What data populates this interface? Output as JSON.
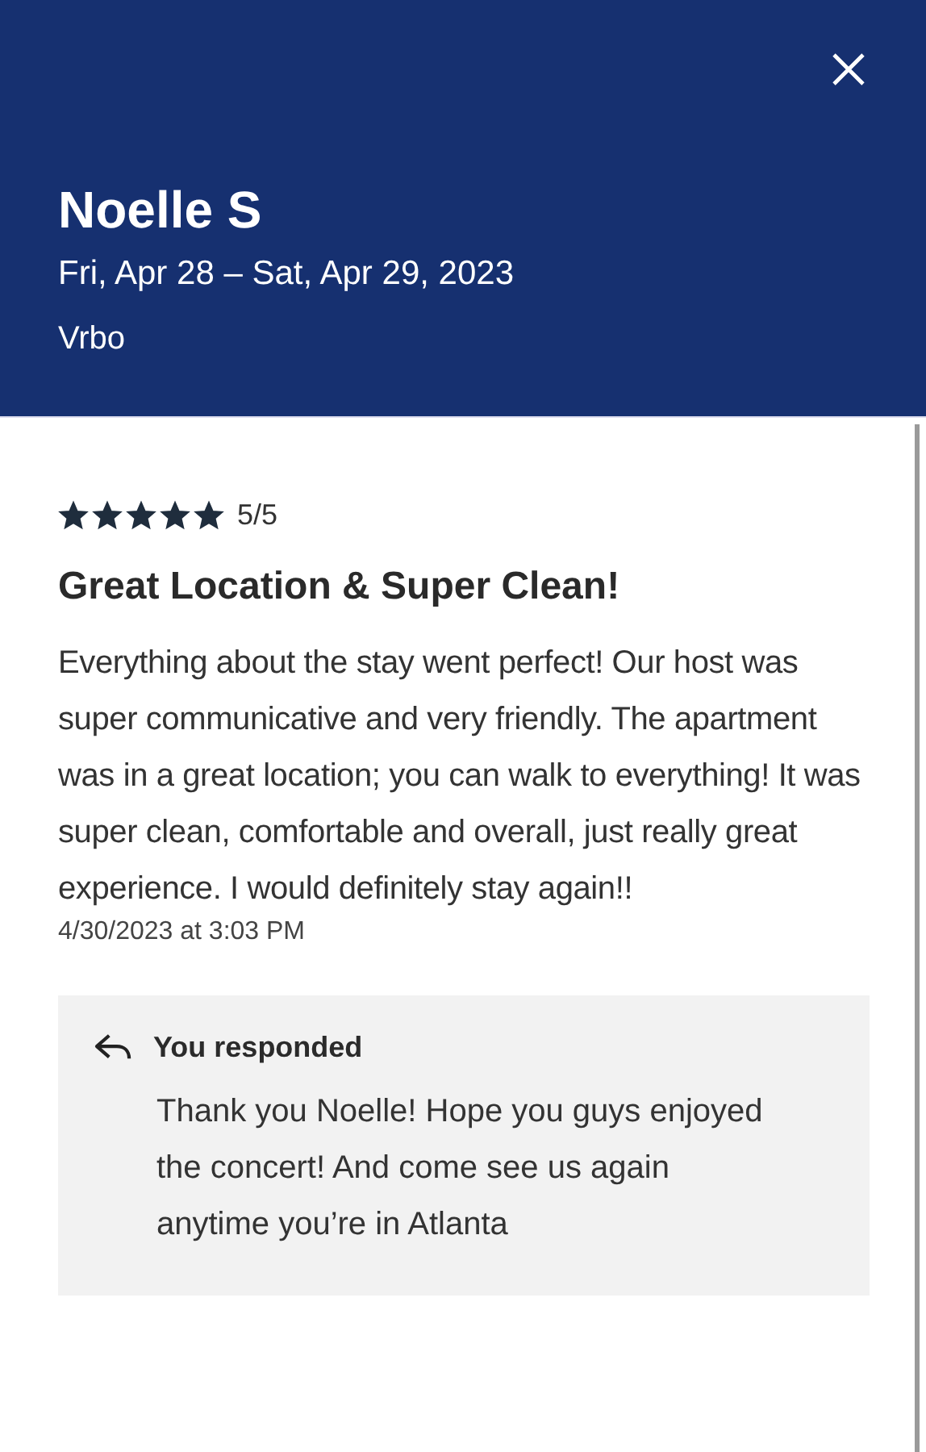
{
  "header": {
    "reviewer": "Noelle S",
    "dates": "Fri, Apr 28 – Sat, Apr 29, 2023",
    "source": "Vrbo"
  },
  "review": {
    "stars": 5,
    "rating": "5/5",
    "title": "Great Location & Super Clean!",
    "body": "Everything about the stay went perfect! Our host was super communicative and very friendly. The apartment was in a great location; you can walk to everything! It was super clean, comfortable and overall, just really great experience. I would definitely stay again!!",
    "timestamp": "4/30/2023 at 3:03 PM"
  },
  "response": {
    "label": "You responded",
    "text": "Thank you Noelle! Hope you guys enjoyed the concert! And come see us again anytime you’re in Atlanta"
  }
}
